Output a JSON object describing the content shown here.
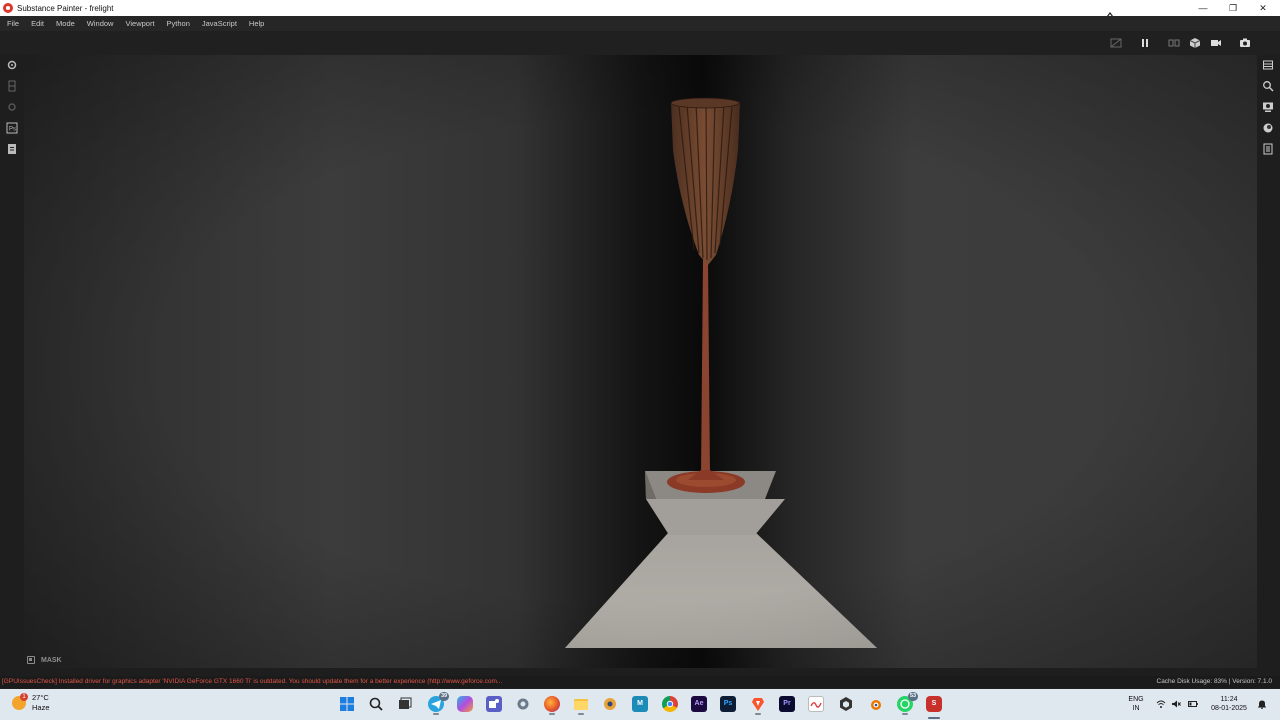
{
  "window": {
    "title": "Substance Painter - frelight",
    "minimize": "—",
    "restore": "❐",
    "close": "✕"
  },
  "menu": [
    "File",
    "Edit",
    "Mode",
    "Window",
    "Viewport",
    "Python",
    "JavaScript",
    "Help"
  ],
  "toolbar_icons": [
    "hide-icon",
    "pause-icon",
    "split-view-icon",
    "cube-view-icon",
    "camera-icon",
    "screenshot-icon"
  ],
  "left_tools": [
    "settings-icon",
    "history-icon",
    "gear-icon",
    "photoshop-export-icon",
    "document-icon"
  ],
  "right_tools": [
    "layers-icon",
    "zoom-icon",
    "display-icon",
    "shader-icon",
    "properties-icon"
  ],
  "viewport": {
    "mask_label": "MASK"
  },
  "status": {
    "log": "[GPUIssuesCheck] Installed driver for graphics adapter 'NVIDIA GeForce GTX 1660 Ti' is outdated. You should update them for a better experience (http://www.geforce.com...",
    "cache": "Cache Disk Usage:   83% | Version: 7.1.0"
  },
  "taskbar": {
    "weather": {
      "temp": "27°C",
      "condition": "Haze",
      "alert": "1"
    },
    "apps": [
      {
        "name": "start-icon",
        "label": ""
      },
      {
        "name": "search-icon",
        "label": ""
      },
      {
        "name": "task-view-icon",
        "label": ""
      },
      {
        "name": "telegram-icon",
        "label": "",
        "badge": "39"
      },
      {
        "name": "copilot-icon",
        "label": ""
      },
      {
        "name": "teams-icon",
        "label": ""
      },
      {
        "name": "settings-app-icon",
        "label": ""
      },
      {
        "name": "firefox-icon",
        "label": ""
      },
      {
        "name": "file-explorer-icon",
        "label": ""
      },
      {
        "name": "blender-alt-icon",
        "label": ""
      },
      {
        "name": "maps-icon",
        "label": "M"
      },
      {
        "name": "chrome-icon",
        "label": ""
      },
      {
        "name": "after-effects-icon",
        "label": "Ae"
      },
      {
        "name": "photoshop-icon",
        "label": "Ps"
      },
      {
        "name": "brave-icon",
        "label": ""
      },
      {
        "name": "premiere-icon",
        "label": "Pr"
      },
      {
        "name": "notepad-icon",
        "label": ""
      },
      {
        "name": "unity-icon",
        "label": ""
      },
      {
        "name": "blender-icon",
        "label": ""
      },
      {
        "name": "whatsapp-icon",
        "label": "",
        "badge": "53"
      },
      {
        "name": "substance-painter-icon",
        "label": "S"
      }
    ],
    "tray": {
      "lang_top": "ENG",
      "lang_bottom": "IN",
      "time": "11:24",
      "date": "08-01-2025"
    }
  },
  "colors": {
    "accent_red": "#e25545",
    "taskbar_bg": "#dfe7ef",
    "model_wood": "#6e4630",
    "model_rust": "#8a3a26",
    "model_stone": "#a9a5a0"
  }
}
